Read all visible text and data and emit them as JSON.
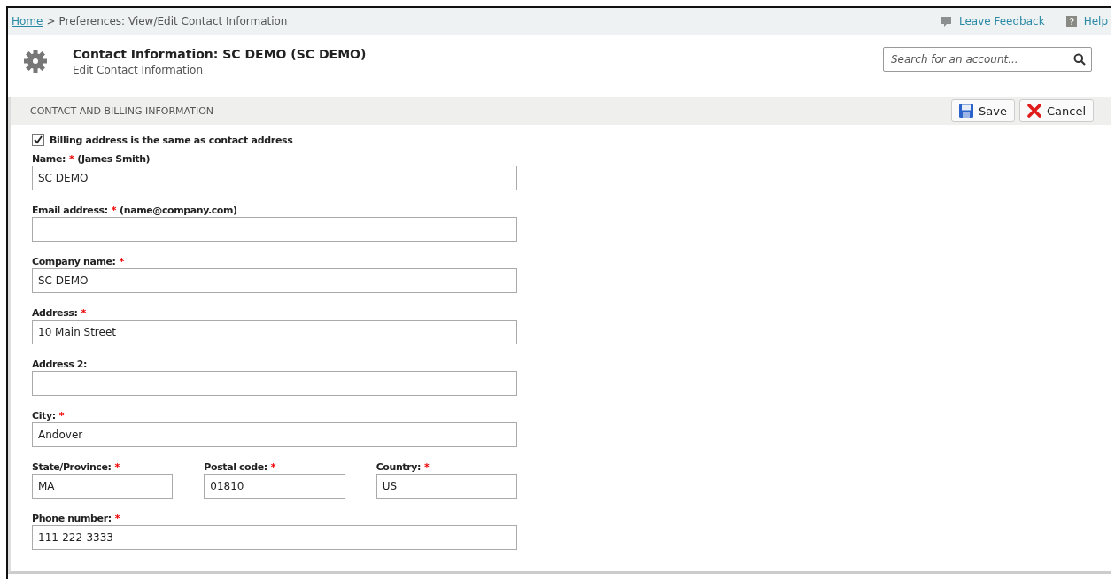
{
  "breadcrumb": {
    "home": "Home",
    "separator": ">",
    "current": "Preferences: View/Edit Contact Information"
  },
  "top_links": [
    {
      "kind": "feedback",
      "label": "Leave Feedback"
    },
    {
      "kind": "help",
      "label": "Help"
    }
  ],
  "header": {
    "title": "Contact Information: SC DEMO (SC DEMO)",
    "subtitle": "Edit Contact Information"
  },
  "search": {
    "placeholder": "Search for an account..."
  },
  "section": {
    "title": "CONTACT AND BILLING INFORMATION"
  },
  "buttons": [
    {
      "kind": "save",
      "label": "Save"
    },
    {
      "kind": "cancel",
      "label": "Cancel"
    }
  ],
  "billing_same": {
    "label": "Billing address is the same as contact address",
    "checked": true
  },
  "rows": [
    [
      {
        "label": "Name:",
        "required_mark": "*",
        "hint": "(James Smith)",
        "value": "SC DEMO"
      }
    ],
    [
      {
        "label": "Email address:",
        "required_mark": "*",
        "hint": "(name@company.com)"
      }
    ],
    [
      {
        "label": "Company name:",
        "required_mark": "*",
        "value": "SC DEMO"
      }
    ],
    [
      {
        "label": "Address:",
        "required_mark": "*",
        "value": "10 Main Street"
      }
    ],
    [
      {
        "label": "Address 2:"
      }
    ],
    [
      {
        "label": "City:",
        "required_mark": "*",
        "value": "Andover"
      }
    ],
    [
      {
        "label": "State/Province:",
        "required_mark": "*",
        "value": "MA"
      },
      {
        "label": "Postal code:",
        "required_mark": "*",
        "value": "01810"
      },
      {
        "label": "Country:",
        "required_mark": "*",
        "value": "US"
      }
    ],
    [
      {
        "label": "Phone number:",
        "required_mark": "*",
        "value": "111-222-3333"
      }
    ]
  ]
}
